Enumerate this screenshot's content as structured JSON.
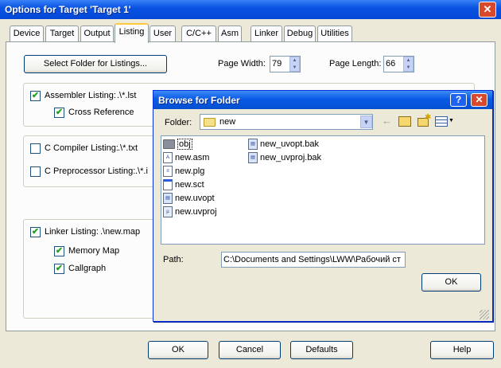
{
  "window": {
    "title": "Options for Target 'Target 1'",
    "close_glyph": "✕"
  },
  "tabs": [
    "Device",
    "Target",
    "Output",
    "Listing",
    "User",
    "C/C++",
    "Asm",
    "Linker",
    "Debug",
    "Utilities"
  ],
  "active_tab": "Listing",
  "listing": {
    "select_folder_label": "Select Folder for Listings...",
    "page_width_label": "Page Width:",
    "page_width_value": "79",
    "page_length_label": "Page Length:",
    "page_length_value": "66",
    "assembler_listing": {
      "label": "Assembler Listing:",
      "value": ".\\*.lst",
      "checked": true
    },
    "cross_reference": {
      "label": "Cross Reference",
      "checked": true
    },
    "c_compiler_listing": {
      "label": "C Compiler Listing:",
      "value": ".\\*.txt",
      "checked": false
    },
    "c_preprocessor_listing": {
      "label": "C Preprocessor Listing:",
      "value": ".\\*.i",
      "checked": false
    },
    "linker_listing": {
      "label": "Linker Listing:",
      "value": ".\\new.map",
      "checked": true
    },
    "memory_map": {
      "label": "Memory Map",
      "checked": true
    },
    "callgraph": {
      "label": "Callgraph",
      "checked": true
    },
    "check_glyph": "✔"
  },
  "footer": {
    "ok": "OK",
    "cancel": "Cancel",
    "defaults": "Defaults",
    "help": "Help"
  },
  "browse_dialog": {
    "title": "Browse for Folder",
    "help_glyph": "?",
    "close_glyph": "✕",
    "folder_label": "Folder:",
    "folder_value": "new",
    "files_col1": [
      {
        "name": "obj",
        "icon": "folder-icon"
      },
      {
        "name": "new.asm",
        "icon": "asm-file-icon"
      },
      {
        "name": "new.plg",
        "icon": "plg-file-icon"
      },
      {
        "name": "new.sct",
        "icon": "sct-file-icon"
      },
      {
        "name": "new.uvopt",
        "icon": "uvopt-file-icon"
      },
      {
        "name": "new.uvproj",
        "icon": "uvproj-file-icon"
      }
    ],
    "files_col2": [
      {
        "name": "new_uvopt.bak",
        "icon": "bak-file-icon"
      },
      {
        "name": "new_uvproj.bak",
        "icon": "bak-file-icon"
      }
    ],
    "path_label": "Path:",
    "path_value": "C:\\Documents and Settings\\LWW\\Рабочий ст",
    "ok": "OK"
  }
}
